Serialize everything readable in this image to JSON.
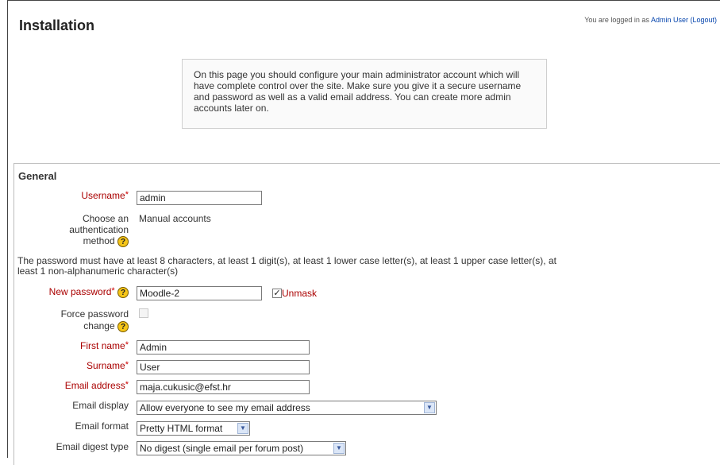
{
  "header": {
    "title": "Installation",
    "login_prefix": "You are logged in as ",
    "user_name": "Admin User",
    "logout_label": "(Logout)"
  },
  "notice": {
    "text": "On this page you should configure your main administrator account which will have complete control over the site. Make sure you give it a secure username and password as well as a valid email address. You can create more admin accounts later on."
  },
  "form": {
    "legend": "General",
    "username": {
      "label": "Username",
      "value": "admin"
    },
    "auth": {
      "label_line1": "Choose an",
      "label_line2": "authentication",
      "label_line3": "method",
      "value": "Manual accounts"
    },
    "password_rules": "The password must have at least 8 characters, at least 1 digit(s), at least 1 lower case letter(s), at least 1 upper case letter(s), at least 1 non-alphanumeric character(s)",
    "new_password": {
      "label": "New password",
      "value": "Moodle-2",
      "unmask_label": "Unmask",
      "unmask_checked": true
    },
    "force_change": {
      "label_line1": "Force password",
      "label_line2": "change",
      "checked": false
    },
    "first_name": {
      "label": "First name",
      "value": "Admin"
    },
    "surname": {
      "label": "Surname",
      "value": "User"
    },
    "email": {
      "label": "Email address",
      "value": "maja.cukusic@efst.hr"
    },
    "email_display": {
      "label": "Email display",
      "value": "Allow everyone to see my email address"
    },
    "email_format": {
      "label": "Email format",
      "value": "Pretty HTML format"
    },
    "email_digest": {
      "label": "Email digest type",
      "value": "No digest (single email per forum post)"
    },
    "required_marker": "*",
    "help_glyph": "?"
  },
  "colors": {
    "required": "#aa0000",
    "link": "#0645ad",
    "help_icon": "#f5c518"
  }
}
